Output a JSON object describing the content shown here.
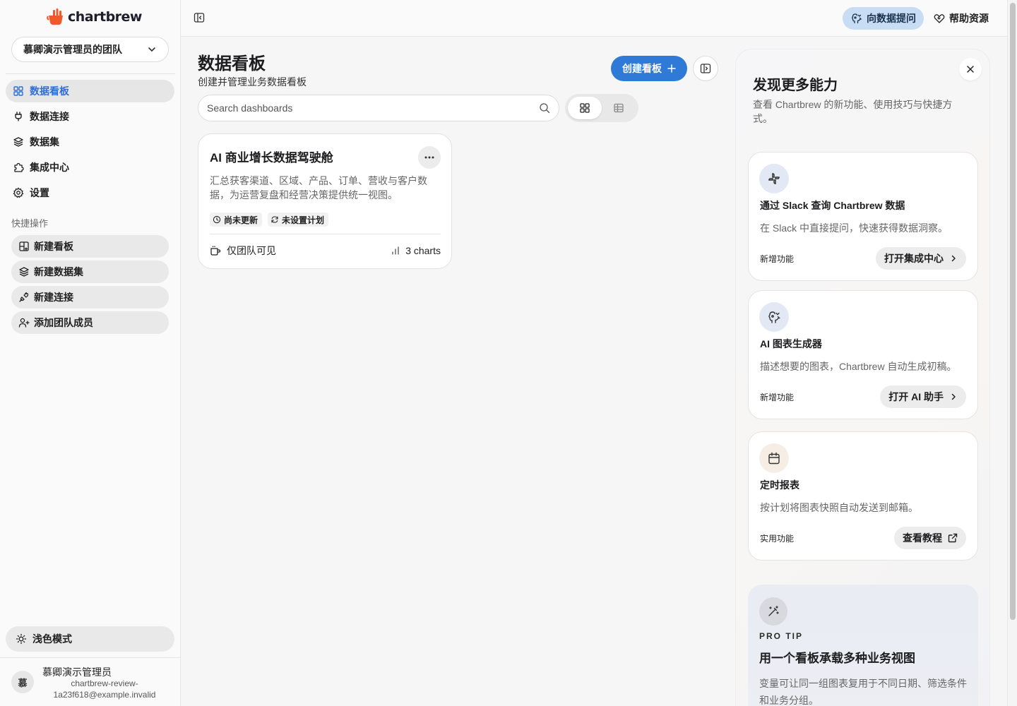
{
  "app": {
    "logo_text": "chartbrew"
  },
  "sidebar": {
    "team": "慕卿演示管理员的团队",
    "nav": [
      {
        "label": "数据看板",
        "icon": "grid-icon",
        "active": true
      },
      {
        "label": "数据连接",
        "icon": "plug-icon"
      },
      {
        "label": "数据集",
        "icon": "layers-icon"
      },
      {
        "label": "集成中心",
        "icon": "puzzle-icon"
      },
      {
        "label": "设置",
        "icon": "gear-icon"
      }
    ],
    "quick_actions_title": "快捷操作",
    "quick_actions": [
      {
        "label": "新建看板",
        "icon": "grid-plus-icon"
      },
      {
        "label": "新建数据集",
        "icon": "layers-plus-icon"
      },
      {
        "label": "新建连接",
        "icon": "plug-plus-icon"
      },
      {
        "label": "添加团队成员",
        "icon": "user-plus-icon"
      }
    ],
    "theme_toggle": "浅色模式",
    "user": {
      "initial": "慕",
      "name": "慕卿演示管理员",
      "email": "chartbrew-review-1a23f618@example.invalid"
    }
  },
  "topbar": {
    "ask_data": "向数据提问",
    "help": "帮助资源"
  },
  "main": {
    "title": "数据看板",
    "subtitle": "创建并管理业务数据看板",
    "create_button": "创建看板",
    "search_placeholder": "Search dashboards",
    "dashboards": [
      {
        "title": "AI 商业增长数据驾驶舱",
        "description": "汇总获客渠道、区域、产品、订单、营收与客户数据，为运营复盘和经营决策提供统一视图。",
        "tags": [
          "尚未更新",
          "未设置计划"
        ],
        "visibility": "仅团队可见",
        "charts": "3 charts"
      }
    ]
  },
  "panel": {
    "title": "发现更多能力",
    "description": "查看 Chartbrew 的新功能、使用技巧与快捷方式。",
    "features": [
      {
        "title": "通过 Slack 查询 Chartbrew 数据",
        "description": "在 Slack 中直接提问，快速获得数据洞察。",
        "tag": "新增功能",
        "button": "打开集成中心",
        "icon": "slack-icon"
      },
      {
        "title": "AI 图表生成器",
        "description": "描述想要的图表，Chartbrew 自动生成初稿。",
        "tag": "新增功能",
        "button": "打开 AI 助手",
        "icon": "ai-brain-icon"
      },
      {
        "title": "定时报表",
        "description": "按计划将图表快照自动发送到邮箱。",
        "tag": "实用功能",
        "button": "查看教程",
        "icon": "calendar-icon"
      }
    ],
    "tip": {
      "label": "PRO TIP",
      "title": "用一个看板承载多种业务视图",
      "description": "变量可让同一组图表复用于不同日期、筛选条件和业务分组。"
    }
  },
  "colors": {
    "accent": "#2f7ad6",
    "active_nav": "#2f6fd6",
    "ask_bg": "#c8ddf3",
    "brand_orange": "#f05a2a"
  }
}
